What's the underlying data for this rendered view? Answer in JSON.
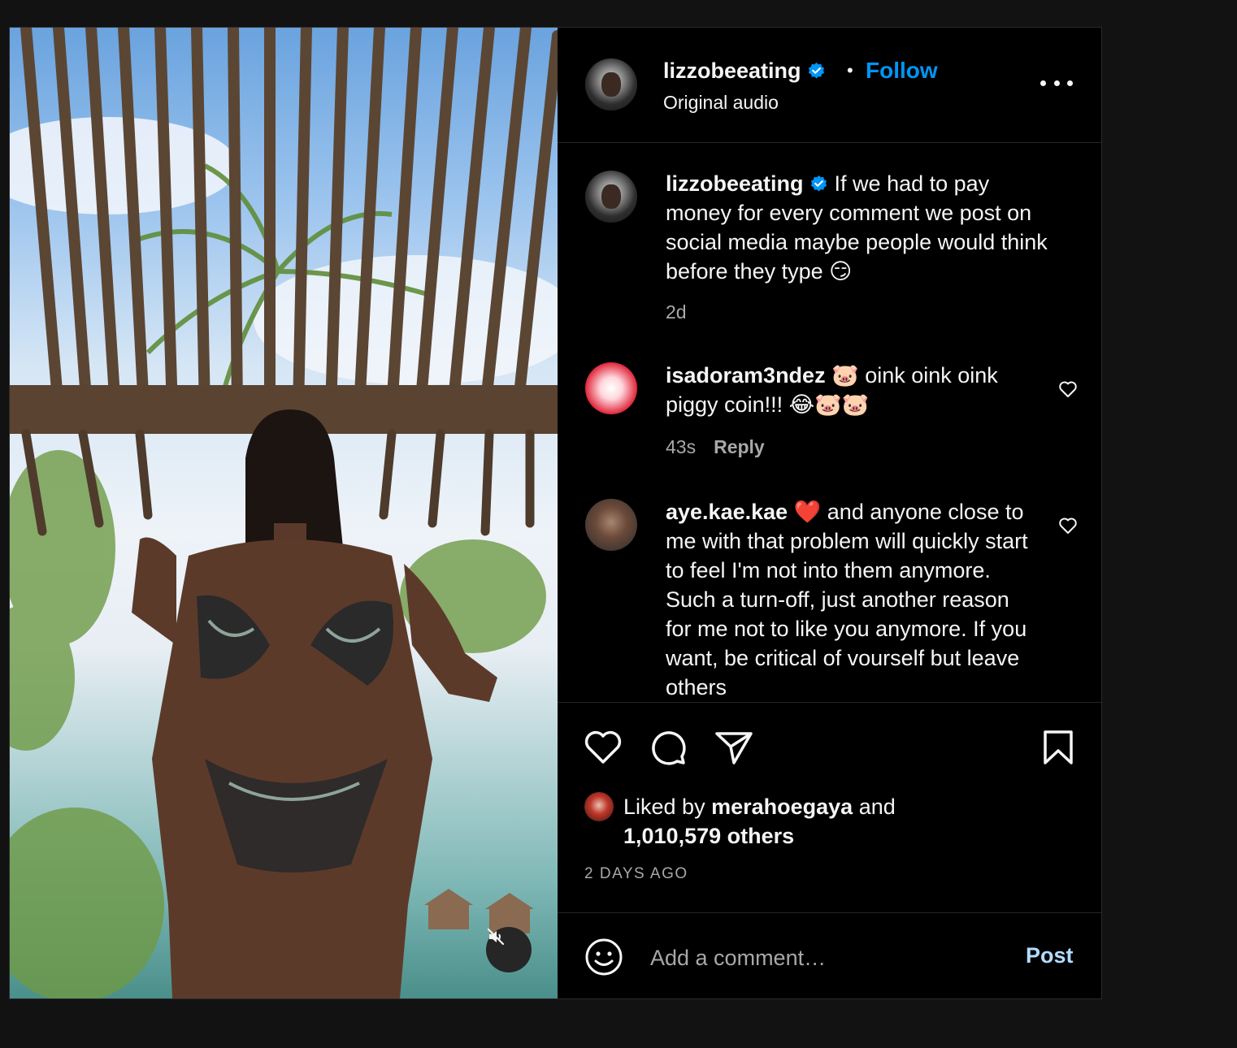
{
  "header": {
    "username": "lizzobeeating",
    "separator": "•",
    "follow_label": "Follow",
    "audio_label": "Original audio",
    "more_icon": "more-horizontal-icon"
  },
  "caption": {
    "username": "lizzobeeating",
    "text": "If we had to pay money for every comment we post on social media maybe people would think before they type 😏",
    "time": "2d"
  },
  "comments": [
    {
      "username": "isadoram3ndez",
      "text": "🐷 oink oink oink piggy coin!!! 😂🐷🐷",
      "time": "43s",
      "reply_label": "Reply"
    },
    {
      "username": "aye.kae.kae",
      "text": "❤️ and anyone close to me with that problem will quickly start to feel I'm not into them anymore. Such a turn-off, just another reason for me not to like you anymore. If you want, be critical of vourself but leave others"
    }
  ],
  "likes": {
    "prefix": "Liked by",
    "liker": "merahoegaya",
    "conjunction": "and",
    "others": "1,010,579 others"
  },
  "date_label": "2 DAYS AGO",
  "composer": {
    "placeholder": "Add a comment…",
    "post_label": "Post"
  },
  "colors": {
    "accent": "#0095f6",
    "post_disabled": "#b3dbff",
    "secondary_text": "#a8a8a8",
    "background": "#000000"
  }
}
